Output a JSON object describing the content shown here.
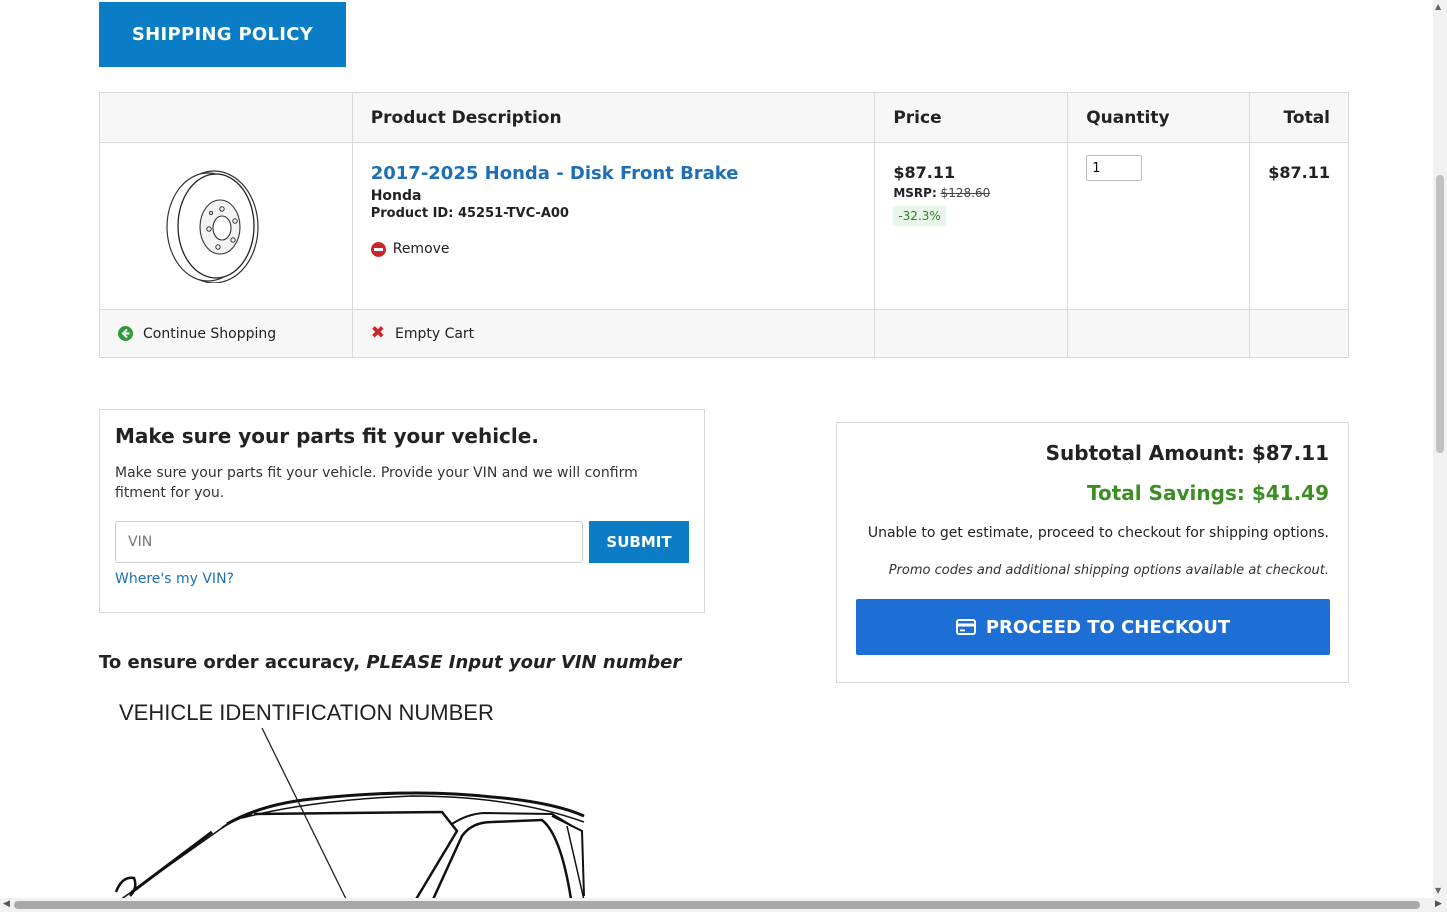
{
  "shipping_policy_label": "SHIPPING POLICY",
  "cart": {
    "headers": {
      "description": "Product Description",
      "price": "Price",
      "quantity": "Quantity",
      "total": "Total"
    },
    "item": {
      "title": "2017-2025 Honda - Disk Front Brake",
      "brand": "Honda",
      "product_id": "Product ID: 45251-TVC-A00",
      "remove_label": "Remove",
      "price": "$87.11",
      "msrp_label": "MSRP:",
      "msrp_value": "$128.60",
      "discount": "-32.3%",
      "quantity": "1",
      "total": "$87.11",
      "image_icon": "brake-disc-image"
    },
    "continue_label": "Continue Shopping",
    "empty_label": "Empty Cart"
  },
  "vin_box": {
    "title": "Make sure your parts fit your vehicle.",
    "text": "Make sure your parts fit your vehicle. Provide your VIN and we will confirm fitment for you.",
    "placeholder": "VIN",
    "submit_label": "SUBMIT",
    "help_link": "Where's my VIN?"
  },
  "summary": {
    "subtotal": "Subtotal Amount: $87.11",
    "savings": "Total Savings: $41.49",
    "shipping_note": "Unable to get estimate, proceed to checkout for shipping options.",
    "promo_note": "Promo codes and additional shipping options available at checkout.",
    "checkout_label": "PROCEED TO CHECKOUT"
  },
  "accuracy": {
    "prefix": "To ensure order accuracy,",
    "emphasis": "PLEASE Input your VIN number"
  },
  "vin_illustration_label": "VEHICLE IDENTIFICATION NUMBER",
  "colors": {
    "primary_blue": "#0b7dc6",
    "checkout_blue": "#1d6fd6",
    "link_blue": "#1e6fb3",
    "savings_green": "#3b8f22",
    "remove_red": "#c8262c"
  }
}
